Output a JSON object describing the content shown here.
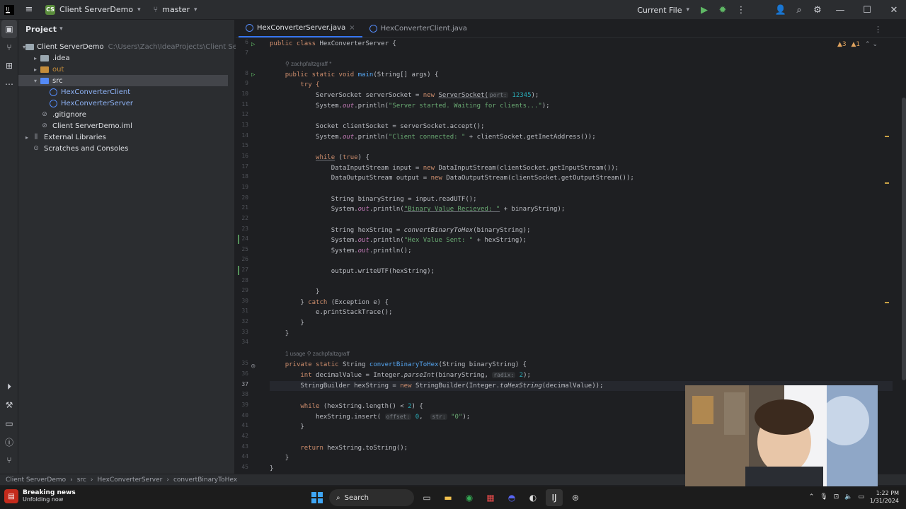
{
  "titlebar": {
    "project_initials": "CS",
    "project_name": "Client ServerDemo",
    "branch": "master",
    "run_config": "Current File"
  },
  "project_panel": {
    "title": "Project",
    "tree": [
      {
        "label": "Client ServerDemo",
        "path": "C:\\Users\\Zach\\IdeaProjects\\Client ServerDem",
        "indent": 0,
        "toggle": "▾",
        "icon": "folder"
      },
      {
        "label": ".idea",
        "indent": 1,
        "toggle": "▸",
        "icon": "folder"
      },
      {
        "label": "out",
        "indent": 1,
        "toggle": "▸",
        "icon": "folder-orange"
      },
      {
        "label": "src",
        "indent": 1,
        "toggle": "▾",
        "icon": "folder-blue"
      },
      {
        "label": "HexConverterClient",
        "indent": 2,
        "toggle": "",
        "icon": "class"
      },
      {
        "label": "HexConverterServer",
        "indent": 2,
        "toggle": "",
        "icon": "class"
      },
      {
        "label": ".gitignore",
        "indent": 1,
        "toggle": "",
        "icon": "file"
      },
      {
        "label": "Client ServerDemo.iml",
        "indent": 1,
        "toggle": "",
        "icon": "file"
      },
      {
        "label": "External Libraries",
        "indent": 0,
        "toggle": "▸",
        "icon": "library"
      },
      {
        "label": "Scratches and Consoles",
        "indent": 0,
        "toggle": "",
        "icon": "scratch"
      }
    ]
  },
  "tabs": [
    {
      "label": "HexConverterServer.java",
      "active": true
    },
    {
      "label": "HexConverterClient.java",
      "active": false
    }
  ],
  "editor": {
    "warnings": "3",
    "weak_warnings": "1",
    "author_1": "zachpfaltzgraff *",
    "usage_label": "1 usage",
    "author_2": "zachpfaltzgraff",
    "line_numbers": [
      "6",
      "7",
      "",
      "8",
      "9",
      "10",
      "11",
      "12",
      "13",
      "14",
      "15",
      "16",
      "17",
      "18",
      "19",
      "20",
      "21",
      "22",
      "23",
      "24",
      "25",
      "26",
      "27",
      "28",
      "29",
      "30",
      "31",
      "32",
      "33",
      "34",
      "",
      "35",
      "36",
      "37",
      "38",
      "39",
      "40",
      "41",
      "42",
      "43",
      "44",
      "45"
    ],
    "code": {
      "l6_a": "public class ",
      "l6_b": "HexConverterServer {",
      "l8_a": "public static void ",
      "l8_fn": "main",
      "l8_b": "(String[] args) {",
      "l9": "try {",
      "l10_a": "ServerSocket serverSocket = ",
      "l10_kw": "new ",
      "l10_b": "ServerSocket(",
      "l10_hint": "port:",
      "l10_num": " 12345",
      "l10_c": ");",
      "l11_a": "System.",
      "l11_out": "out",
      "l11_b": ".println(",
      "l11_str": "\"Server started. Waiting for clients...\"",
      "l11_c": ");",
      "l13": "Socket clientSocket = serverSocket.accept();",
      "l14_a": "System.",
      "l14_out": "out",
      "l14_b": ".println(",
      "l14_str": "\"Client connected: \"",
      "l14_c": " + clientSocket.getInetAddress());",
      "l16_kw": "while",
      "l16_b": " (",
      "l16_kw2": "true",
      "l16_c": ") {",
      "l17_a": "DataInputStream input = ",
      "l17_kw": "new ",
      "l17_b": "DataInputStream(clientSocket.getInputStream());",
      "l18_a": "DataOutputStream output = ",
      "l18_kw": "new ",
      "l18_b": "DataOutputStream(clientSocket.getOutputStream());",
      "l20": "String binaryString = input.readUTF();",
      "l21_a": "System.",
      "l21_out": "out",
      "l21_b": ".println(",
      "l21_str": "\"Binary Value Recieved: \"",
      "l21_c": " + binaryString);",
      "l23_a": "String hexString = ",
      "l23_fn": "convertBinaryToHex",
      "l23_b": "(binaryString);",
      "l24_a": "System.",
      "l24_out": "out",
      "l24_b": ".println(",
      "l24_str": "\"Hex Value Sent: \"",
      "l24_c": " + hexString);",
      "l25_a": "System.",
      "l25_out": "out",
      "l25_b": ".println();",
      "l27": "output.writeUTF(hexString);",
      "l29": "}",
      "l30_a": "} ",
      "l30_kw": "catch",
      "l30_b": " (Exception e) {",
      "l31": "e.printStackTrace();",
      "l32": "}",
      "l33": "}",
      "l35_kw": "private static ",
      "l35_a": "String ",
      "l35_fn": "convertBinaryToHex",
      "l35_b": "(String binaryString) {",
      "l36_kw": "int ",
      "l36_a": "decimalValue = Integer.",
      "l36_it": "parseInt",
      "l36_b": "(binaryString, ",
      "l36_hint": "radix:",
      "l36_num": " 2",
      "l36_c": ");",
      "l37_a": "StringBuilder hexString = ",
      "l37_kw": "new ",
      "l37_b": "StringBuilder(Integer.",
      "l37_it": "toHexString",
      "l37_c": "(decimalValue));",
      "l39_kw": "while",
      "l39_a": " (hexString.length() < ",
      "l39_num": "2",
      "l39_b": ") {",
      "l40_a": "hexString.insert( ",
      "l40_hint1": "offset:",
      "l40_num": " 0",
      "l40_b": ",  ",
      "l40_hint2": "str:",
      "l40_str": " \"0\"",
      "l40_c": ");",
      "l41": "}",
      "l43_kw": "return ",
      "l43_a": "hexString.toString();",
      "l44": "}",
      "l45": "}"
    }
  },
  "statusbar": {
    "crumbs": [
      "Client ServerDemo",
      "src",
      "HexConverterServer",
      "convertBinaryToHex"
    ]
  },
  "taskbar": {
    "news_title": "Breaking news",
    "news_sub": "Unfolding now",
    "search_label": "Search",
    "time": "1:22 PM",
    "date": "1/31/2024"
  }
}
